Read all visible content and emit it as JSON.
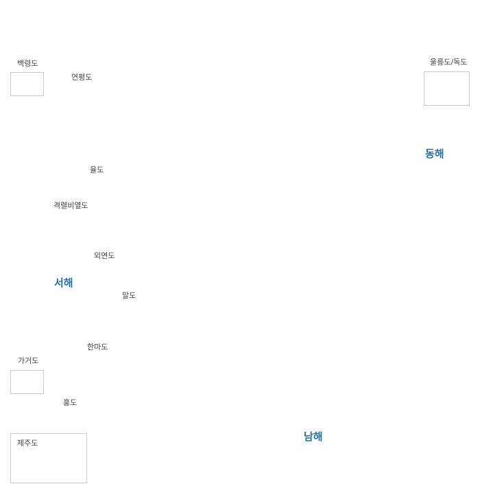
{
  "islands": {
    "baengnyeongdo": "백령도",
    "yeonpyeongdo": "연평도",
    "ulleungdo_dokdo": "울릉도/독도",
    "yuldo": "율도",
    "gyeongnyeolbiyeoldo": "격렬비열도",
    "oeyeondo": "외연도",
    "maldo": "말도",
    "hanmado": "한마도",
    "gageodo": "가거도",
    "hongdo": "홍도",
    "jejudo": "제주도"
  },
  "seas": {
    "east": "동해",
    "west": "서해",
    "south": "남해"
  },
  "colors": {
    "sea_label": "#1f6fa5",
    "island_label": "#444444",
    "inset_border": "#c8c8c8"
  }
}
